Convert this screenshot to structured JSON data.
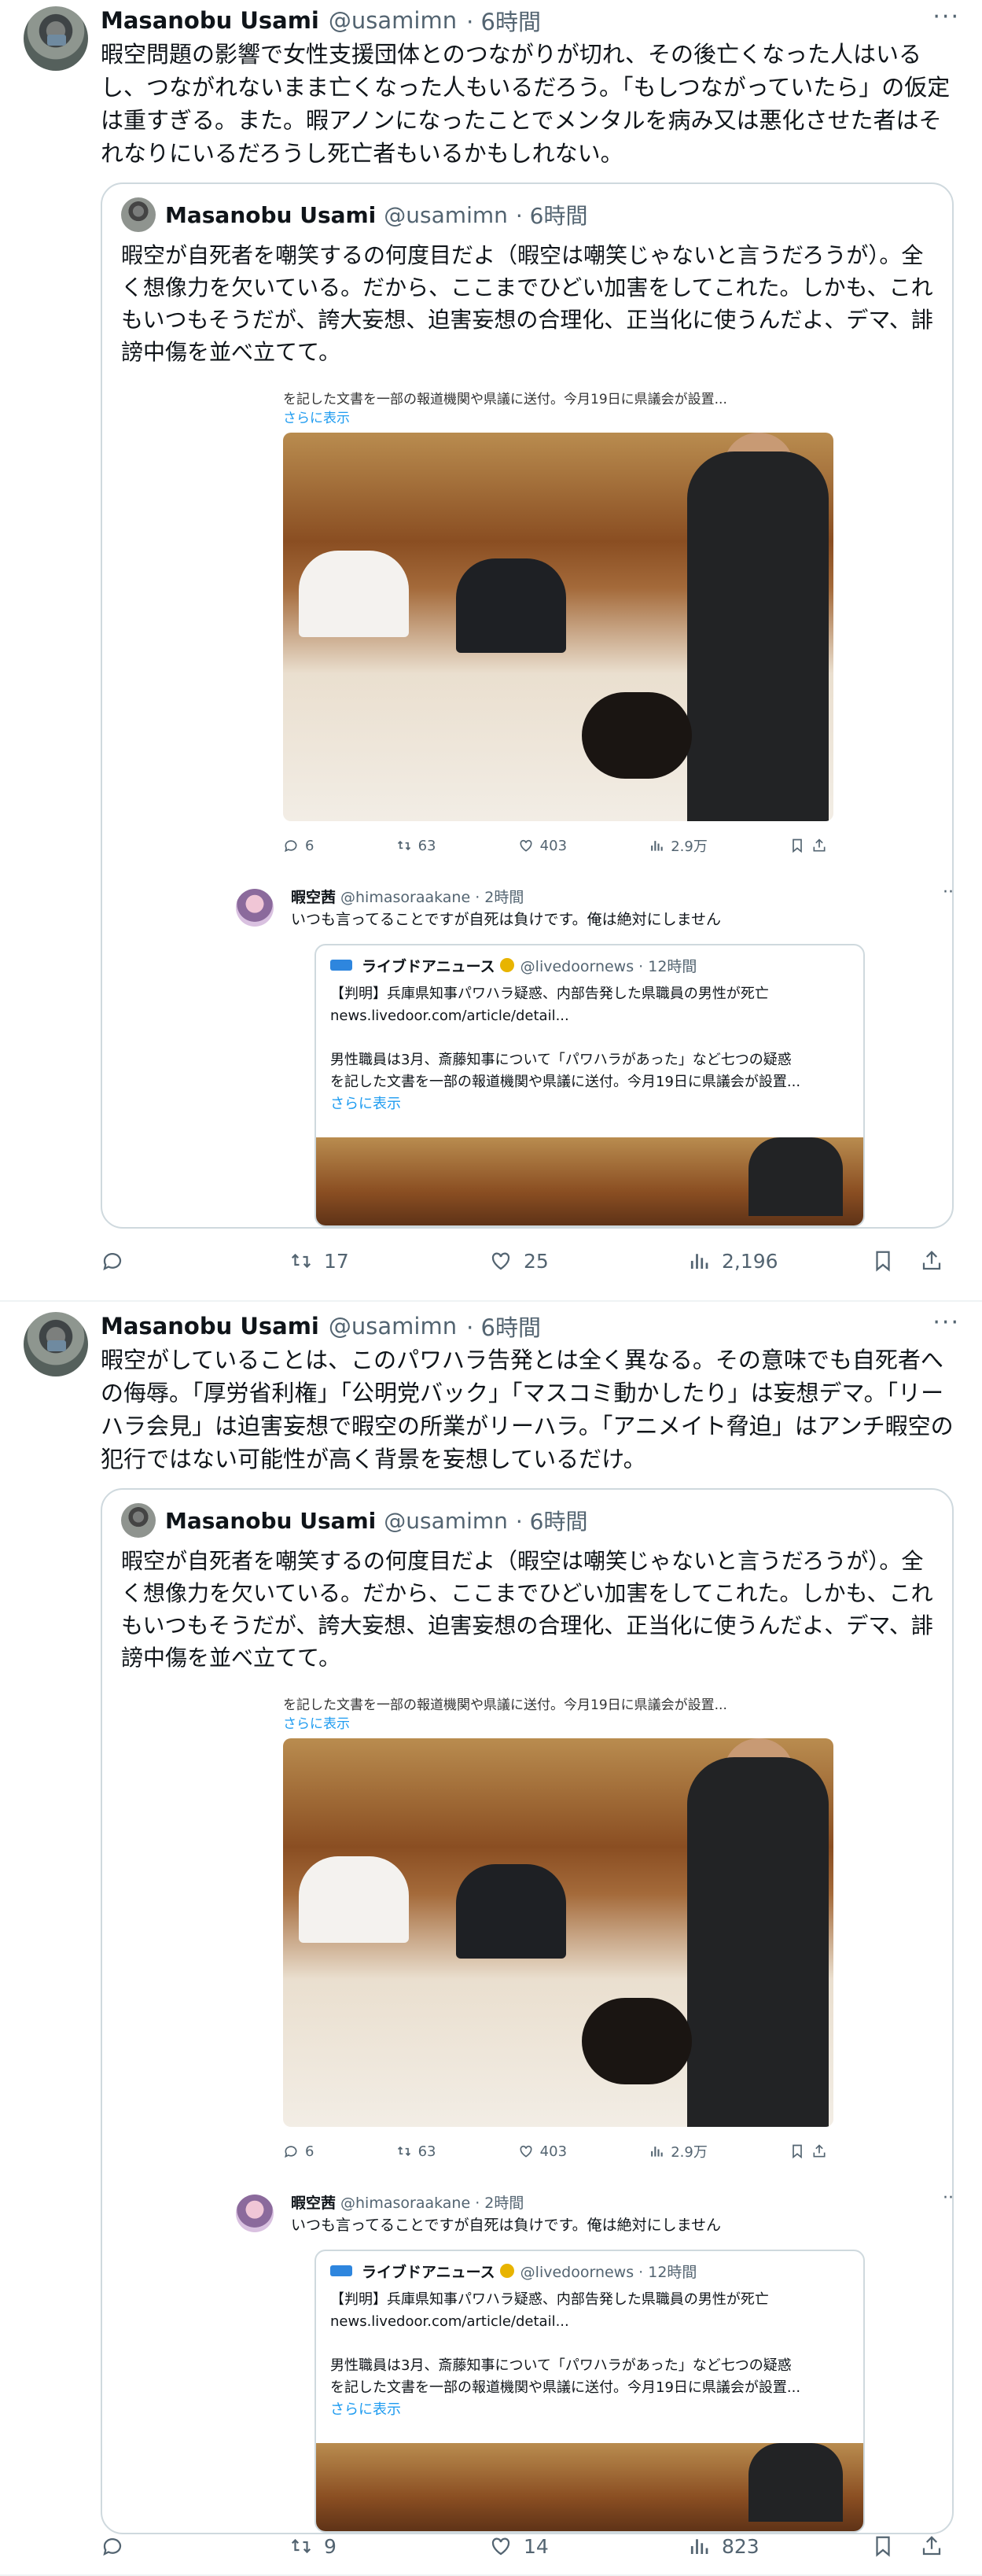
{
  "posts": [
    {
      "author": {
        "name": "Masanobu Usami",
        "handle": "@usamimn",
        "time": "· 6時間"
      },
      "text": "暇空問題の影響で女性支援団体とのつながりが切れ、その後亡くなった人はいるし、つながれないまま亡くなった人もいるだろう。「もしつながっていたら」の仮定は重すぎる。また。暇アノンになったことでメンタルを病み又は悪化させた者はそれなりにいるだろうし死亡者もいるかもしれない。",
      "quote": {
        "author": {
          "name": "Masanobu Usami",
          "handle": "@usamimn",
          "time": "· 6時間"
        },
        "text": "暇空が自死者を嘲笑するの何度目だよ（暇空は嘲笑じゃないと言うだろうが）。全く想像力を欠いている。だから、ここまでひどい加害をしてこれた。しかも、これもいつもそうだが、誇大妄想、迫害妄想の合理化、正当化に使うんだよ、デマ、誹謗中傷を並べ立てて。",
        "screenshot": {
          "snippet": "を記した文書を一部の報道機関や県議に送付。今月19日に県議会が設置...",
          "more": "さらに表示",
          "stats": {
            "replies": "6",
            "retweets": "63",
            "likes": "403",
            "views": "2.9万"
          },
          "reply": {
            "name": "暇空茜",
            "handle": "@himasoraakane · 2時間",
            "text": "いつも言ってることですが自死は負けです。俺は絶対にしません",
            "inner": {
              "name": "ライブドアニュース",
              "handle": "@livedoornews · 12時間",
              "line1": "【判明】兵庫県知事パワハラ疑惑、内部告発した県職員の男性が死亡",
              "line2": "news.livedoor.com/article/detail...",
              "line3": "男性職員は3月、斎藤知事について「パワハラがあった」など七つの疑惑",
              "line4": "を記した文書を一部の報道機関や県議に送付。今月19日に県議会が設置...",
              "more": "さらに表示"
            }
          }
        }
      },
      "actions": {
        "replies": "",
        "retweets": "17",
        "likes": "25",
        "views": "2,196"
      }
    },
    {
      "author": {
        "name": "Masanobu Usami",
        "handle": "@usamimn",
        "time": "· 6時間"
      },
      "text": "暇空がしていることは、このパワハラ告発とは全く異なる。その意味でも自死者への侮辱。「厚労省利権」「公明党バック」「マスコミ動かしたり」は妄想デマ。「リーハラ会見」は迫害妄想で暇空の所業がリーハラ。「アニメイト脅迫」はアンチ暇空の犯行ではない可能性が高く背景を妄想しているだけ。",
      "quote": {
        "author": {
          "name": "Masanobu Usami",
          "handle": "@usamimn",
          "time": "· 6時間"
        },
        "text": "暇空が自死者を嘲笑するの何度目だよ（暇空は嘲笑じゃないと言うだろうが）。全く想像力を欠いている。だから、ここまでひどい加害をしてこれた。しかも、これもいつもそうだが、誇大妄想、迫害妄想の合理化、正当化に使うんだよ、デマ、誹謗中傷を並べ立てて。",
        "screenshot": {
          "snippet": "を記した文書を一部の報道機関や県議に送付。今月19日に県議会が設置...",
          "more": "さらに表示",
          "stats": {
            "replies": "6",
            "retweets": "63",
            "likes": "403",
            "views": "2.9万"
          },
          "reply": {
            "name": "暇空茜",
            "handle": "@himasoraakane · 2時間",
            "text": "いつも言ってることですが自死は負けです。俺は絶対にしません",
            "inner": {
              "name": "ライブドアニュース",
              "handle": "@livedoornews · 12時間",
              "line1": "【判明】兵庫県知事パワハラ疑惑、内部告発した県職員の男性が死亡",
              "line2": "news.livedoor.com/article/detail...",
              "line3": "男性職員は3月、斎藤知事について「パワハラがあった」など七つの疑惑",
              "line4": "を記した文書を一部の報道機関や県議に送付。今月19日に県議会が設置...",
              "more": "さらに表示"
            }
          }
        }
      },
      "actions": {
        "replies": "",
        "retweets": "9",
        "likes": "14",
        "views": "823"
      }
    }
  ],
  "icons": [
    "reply-icon",
    "retweet-icon",
    "like-icon",
    "views-icon",
    "bookmark-icon",
    "share-icon",
    "more-icon",
    "verified-badge-icon"
  ]
}
